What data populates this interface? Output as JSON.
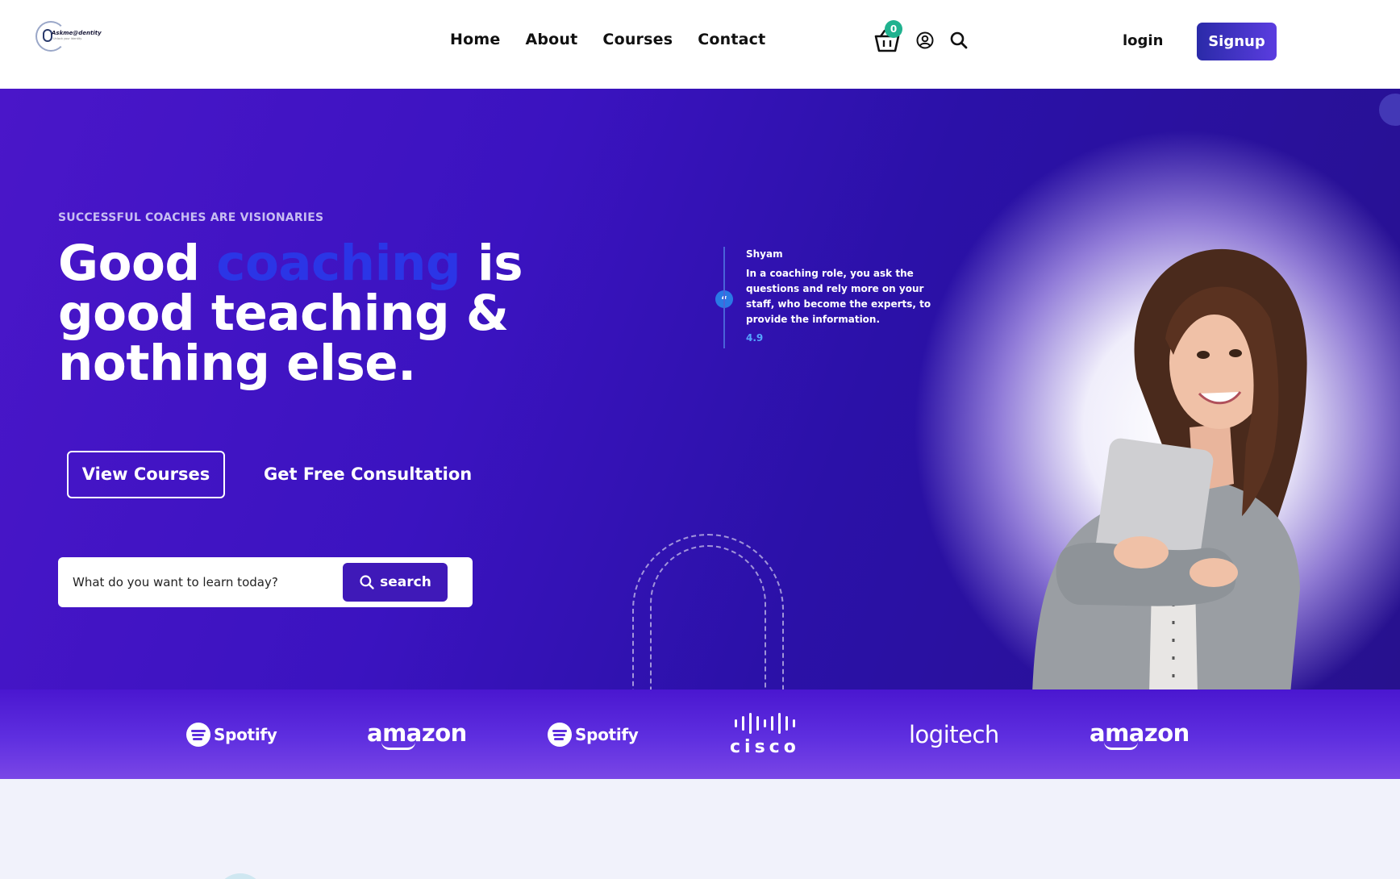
{
  "header": {
    "logo_text": "Askme@dentity",
    "logo_tagline": "Unlock your Identity",
    "nav": [
      "Home",
      "About",
      "Courses",
      "Contact"
    ],
    "cart_count": "0",
    "login_label": "login",
    "signup_label": "Signup"
  },
  "hero": {
    "eyebrow": "SUCCESSFUL COACHES ARE VISIONARIES",
    "headline": {
      "part1": "Good ",
      "highlight": "coaching",
      "part2": " is good teaching & nothing else."
    },
    "view_courses_label": "View Courses",
    "consultation_label": "Get Free Consultation",
    "search": {
      "placeholder": "What do you want to learn today?",
      "button_label": "search"
    },
    "testimonial": {
      "quote_mark": "“",
      "name": "Shyam",
      "text": "In a coaching role, you ask the questions and rely more on your staff, who become the experts, to provide the information.",
      "rating": "4.9"
    }
  },
  "brands": [
    "Spotify",
    "amazon",
    "Spotify",
    "cisco",
    "logitech",
    "amazon"
  ],
  "colors": {
    "hero_primary": "#3b13c0",
    "highlight": "#2b35e6",
    "signup": "#2a2aa8",
    "badge": "#20b28f"
  }
}
